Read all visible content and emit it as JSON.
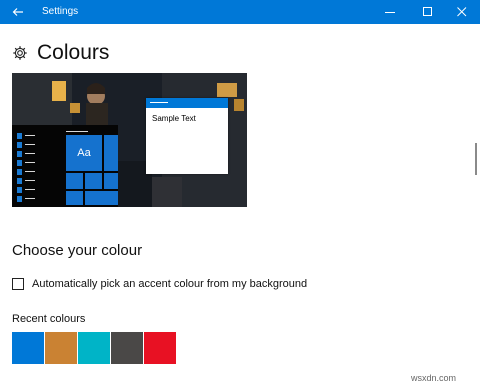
{
  "window": {
    "title": "Settings",
    "back_icon": "back-arrow-icon",
    "minimize_icon": "minimize-icon",
    "maximize_icon": "maximize-icon",
    "close_icon": "close-icon",
    "accent": "#0078d7"
  },
  "page": {
    "title": "Colours",
    "icon": "gear-icon"
  },
  "preview": {
    "sample_text": "Sample Text",
    "tile_label": "Aa",
    "accent": "#1572ce"
  },
  "choose": {
    "heading": "Choose your colour",
    "auto_pick_label": "Automatically pick an accent colour from my background",
    "auto_pick_checked": false
  },
  "recent": {
    "label": "Recent colours",
    "colors": [
      "#0078d7",
      "#ca8233",
      "#00b4c7",
      "#4a4847",
      "#e81123"
    ]
  },
  "watermark": "wsxdn.com"
}
